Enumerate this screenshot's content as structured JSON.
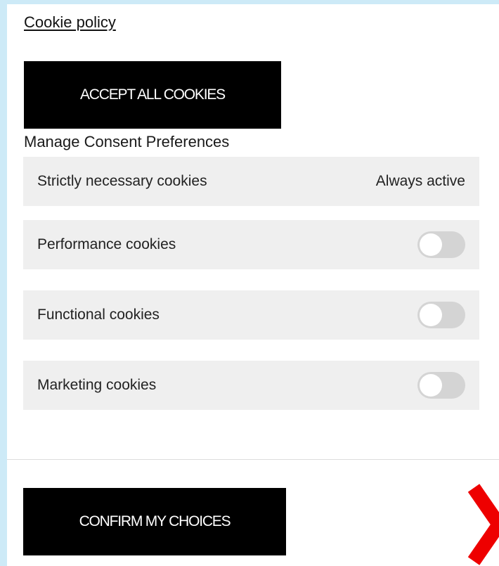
{
  "cookie_policy_link": "Cookie policy",
  "accept_all_label": "ACCEPT ALL COOKIES",
  "manage_heading": "Manage Consent Preferences",
  "preferences": [
    {
      "label": "Strictly necessary cookies",
      "status": "Always active"
    },
    {
      "label": "Performance cookies",
      "enabled": false
    },
    {
      "label": "Functional cookies",
      "enabled": false
    },
    {
      "label": "Marketing cookies",
      "enabled": false
    }
  ],
  "confirm_label": "CONFIRM MY CHOICES",
  "colors": {
    "background": "#cdeaf7",
    "panel": "#ffffff",
    "button": "#000000",
    "row": "#efefef",
    "toggle_off": "#d4d4d4",
    "chevron": "#ee0000"
  },
  "icons": {
    "next": "chevron-right-icon"
  }
}
